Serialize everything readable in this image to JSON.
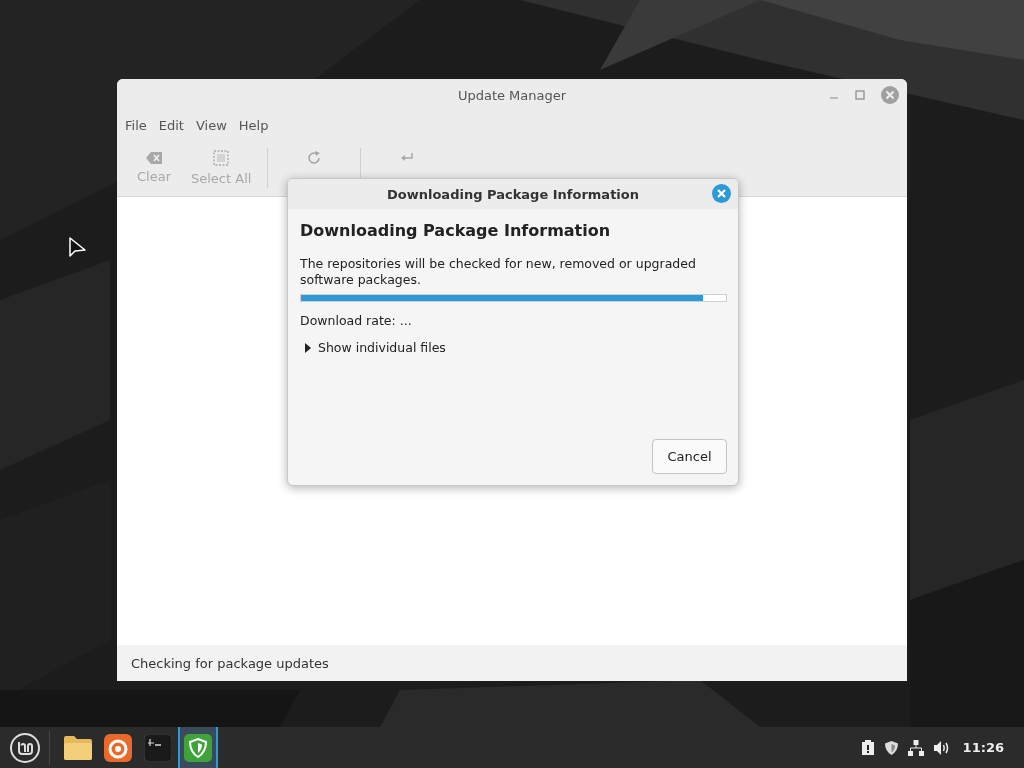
{
  "window": {
    "title": "Update Manager"
  },
  "menu": [
    "File",
    "Edit",
    "View",
    "Help"
  ],
  "toolbar": [
    {
      "label": "Clear",
      "kind": "clear",
      "disabled": true
    },
    {
      "label": "Select All",
      "kind": "select",
      "disabled": true
    },
    {
      "kind": "refresh",
      "disabled": true
    },
    {
      "kind": "install",
      "disabled": true
    }
  ],
  "status_bar": "Checking for package updates",
  "dialog": {
    "title": "Downloading Package Information",
    "heading": "Downloading Package Information",
    "message": "The repositories will be checked for new, removed or upgraded software packages.",
    "progress": {
      "level": 0.945
    },
    "rate": "Download rate: ...",
    "expander": {
      "label": "Show individual files",
      "expanded": false
    },
    "buttons": [
      "Cancel"
    ]
  },
  "taskbar": {
    "apps": [
      {
        "kind": "files",
        "selected": false
      },
      {
        "kind": "browser",
        "selected": false
      },
      {
        "kind": "terminal",
        "selected": false
      },
      {
        "kind": "shield",
        "selected": true
      }
    ],
    "clock": "11:26"
  }
}
